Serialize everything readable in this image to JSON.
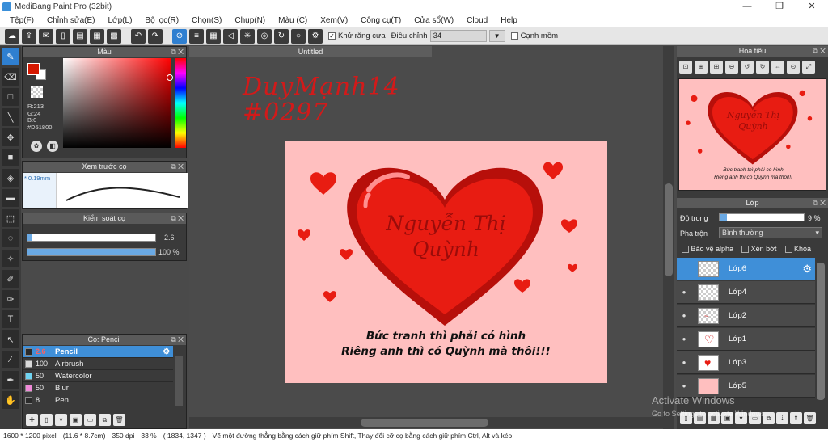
{
  "window": {
    "title": "MediBang Paint Pro (32bit)",
    "min": "—",
    "max": "❐",
    "close": "✕"
  },
  "menu": [
    "Tệp(F)",
    "Chỉnh sửa(E)",
    "Lớp(L)",
    "Bộ lọc(R)",
    "Chọn(S)",
    "Chụp(N)",
    "Màu (C)",
    "Xem(V)",
    "Công cụ(T)",
    "Cửa sổ(W)",
    "Cloud",
    "Help"
  ],
  "toolbar": {
    "antialias_label": "Khử răng cưa",
    "adjust_label": "Điều chỉnh",
    "adjust_value": "34",
    "edge_label": "Cạnh mềm"
  },
  "color_panel": {
    "title": "Màu",
    "r": "R:213",
    "g": "G:24",
    "b": "B:0",
    "hex": "#D51800"
  },
  "brush_preview": {
    "title": "Xem trước cọ",
    "size": "* 0.19mm"
  },
  "brush_control": {
    "title": "Kiểm soát cọ",
    "size_value": "2.6",
    "opacity_value": "100 %",
    "opacity_fraction": 1.0
  },
  "brush_list": {
    "title": "Cọ: Pencil",
    "items": [
      {
        "size": "2.6",
        "name": "Pencil",
        "color": "#2a2a2a",
        "selected": true
      },
      {
        "size": "100",
        "name": "Airbrush",
        "color": "#d8d8d8",
        "selected": false
      },
      {
        "size": "50",
        "name": "Watercolor",
        "color": "#6fd4f2",
        "selected": false
      },
      {
        "size": "50",
        "name": "Blur",
        "color": "#f08ad9",
        "selected": false
      },
      {
        "size": "8",
        "name": "Pen",
        "color": "#2a2a2a",
        "selected": false
      }
    ]
  },
  "document": {
    "tab": "Untitled",
    "handwriting_line1": "DuyMạnh14",
    "handwriting_line2": "#0297"
  },
  "artwork": {
    "heart_text_line1": "Nguyễn Thị",
    "heart_text_line2": "Quỳnh",
    "caption_line1": "Bức tranh thì phải có hình",
    "caption_line2": "Riêng anh thì có Quỳnh mà thôi!!!",
    "heart_color": "#e81c12",
    "bg_color": "#ffbfbf"
  },
  "navigator": {
    "title": "Hoa tiêu"
  },
  "layers": {
    "title": "Lớp",
    "opacity_label": "Độ trong",
    "opacity_value": "9 %",
    "opacity_fraction": 0.09,
    "blend_label": "Pha trộn",
    "blend_value": "Bình thường",
    "protect_alpha": "Bảo vệ alpha",
    "clipping": "Xén bớt",
    "lock": "Khóa",
    "items": [
      {
        "name": "Lớp6",
        "selected": true
      },
      {
        "name": "Lớp4",
        "selected": false
      },
      {
        "name": "Lớp2",
        "selected": false
      },
      {
        "name": "Lớp1",
        "selected": false
      },
      {
        "name": "Lớp3",
        "selected": false
      },
      {
        "name": "Lớp5",
        "selected": false
      }
    ]
  },
  "status": {
    "size": "1600 * 1200 pixel",
    "dims": "(11.6 * 8.7cm)",
    "dpi": "350 dpi",
    "zoom": "33 %",
    "coords": "( 1834, 1347 )",
    "hint": "Vẽ một đường thẳng bằng cách giữ phím Shift, Thay đổi cỡ cọ bằng cách giữ phím Ctrl, Alt và kéo"
  },
  "watermark": {
    "line1": "Activate Windows",
    "line2": "Go to Settings to activate Windows."
  }
}
